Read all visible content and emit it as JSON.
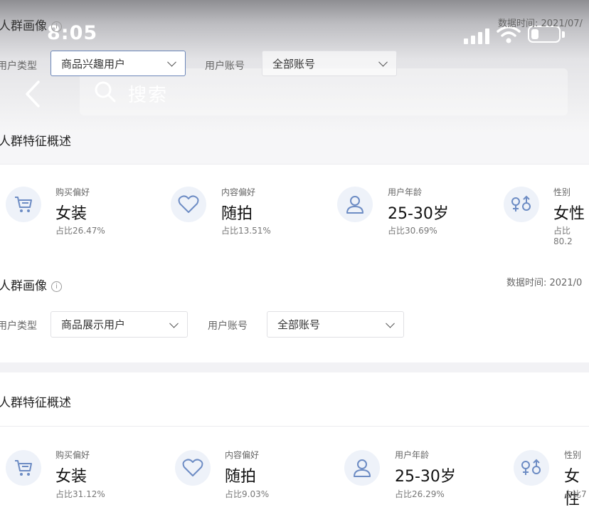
{
  "status_bar": {
    "time": "8:05"
  },
  "search": {
    "placeholder": "搜索"
  },
  "panel1": {
    "title": "人群画像",
    "info_icon": "ⓘ",
    "data_time": "数据时间: 2021/07/",
    "user_type_label": "用户类型",
    "user_type_value": "商品兴趣用户",
    "account_label": "用户账号",
    "account_value": "全部账号",
    "features_title": "人群特征概述",
    "features": [
      {
        "icon": "cart-icon",
        "category": "购买偏好",
        "value": "女装",
        "percent": "占比26.47%"
      },
      {
        "icon": "heart-icon",
        "category": "内容偏好",
        "value": "随拍",
        "percent": "占比13.51%"
      },
      {
        "icon": "user-icon",
        "category": "用户年龄",
        "value": "25-30岁",
        "percent": "占比30.69%"
      },
      {
        "icon": "gender-icon",
        "category": "性别",
        "value": "女性",
        "percent": "占比80.2"
      }
    ]
  },
  "panel2": {
    "title": "人群画像",
    "info_icon": "ⓘ",
    "data_time": "数据时间: 2021/0",
    "user_type_label": "用户类型",
    "user_type_value": "商品展示用户",
    "account_label": "用户账号",
    "account_value": "全部账号",
    "features_title": "人群特征概述",
    "features": [
      {
        "icon": "cart-icon",
        "category": "购买偏好",
        "value": "女装",
        "percent": "占比31.12%"
      },
      {
        "icon": "heart-icon",
        "category": "内容偏好",
        "value": "随拍",
        "percent": "占比9.03%"
      },
      {
        "icon": "user-icon",
        "category": "用户年龄",
        "value": "25-30岁",
        "percent": "占比26.29%"
      },
      {
        "icon": "gender-icon",
        "category": "性别",
        "value": "女性",
        "percent": "占比7"
      }
    ]
  },
  "colors": {
    "accent": "#6b86b8",
    "icon_bg": "#eef2f9",
    "icon_stroke": "#6d8cc4"
  }
}
